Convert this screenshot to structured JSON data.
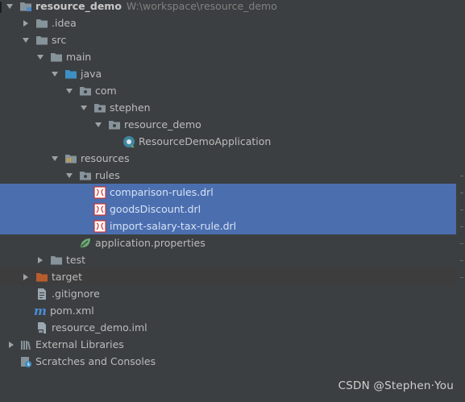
{
  "project": {
    "name": "resource_demo",
    "path": "W:\\workspace\\resource_demo"
  },
  "tree": {
    "idea": ".idea",
    "src": "src",
    "main": "main",
    "java": "java",
    "com": "com",
    "stephen": "stephen",
    "resource_demo": "resource_demo",
    "app_class": "ResourceDemoApplication",
    "resources": "resources",
    "rules": "rules",
    "files": [
      "comparison-rules.drl",
      "goodsDiscount.drl",
      "import-salary-tax-rule.drl"
    ],
    "application_properties": "application.properties",
    "test": "test",
    "target": "target",
    "gitignore": ".gitignore",
    "pom": "pom.xml",
    "iml": "resource_demo.iml",
    "external_libraries": "External Libraries",
    "scratches": "Scratches and Consoles"
  },
  "watermark": "CSDN @Stephen·You",
  "colors": {
    "background": "#3c3f41",
    "selection": "#4b6eaf",
    "folder": "#87939a",
    "source_folder": "#3d8fc4",
    "excluded_folder": "#b75c2e"
  }
}
